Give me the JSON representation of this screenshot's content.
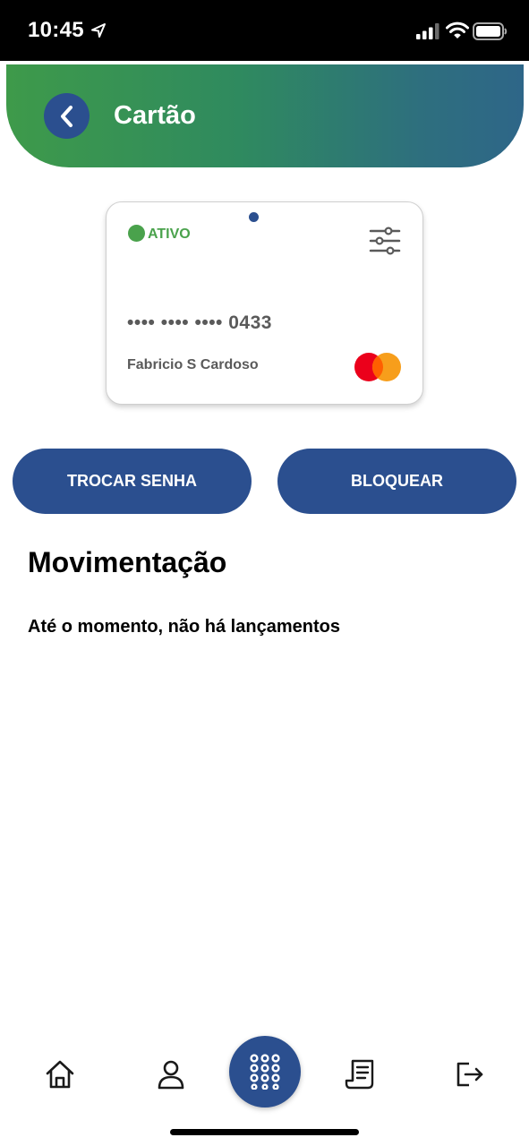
{
  "status_bar": {
    "time": "10:45",
    "icons": [
      "location-arrow-icon",
      "signal-icon",
      "wifi-icon",
      "battery-icon"
    ]
  },
  "header": {
    "title": "Cartão",
    "back_icon": "chevron-left-icon",
    "gradient_colors": [
      "#3e9a4a",
      "#2e6688"
    ]
  },
  "card": {
    "status": "ATIVO",
    "status_color": "#4aa24c",
    "number": "•••• •••• •••• 0433",
    "holder": "Fabricio S Cardoso",
    "brand_icon": "mastercard-logo",
    "settings_icon": "sliders-icon"
  },
  "actions": {
    "change_password": "TROCAR SENHA",
    "block": "BLOQUEAR",
    "color": "#2b4f8f"
  },
  "transactions": {
    "title": "Movimentação",
    "empty_message": "Até o momento, não há lançamentos"
  },
  "bottom_nav": {
    "items": [
      "home-icon",
      "profile-icon",
      "apps-grid-icon",
      "statement-icon",
      "logout-icon"
    ]
  }
}
